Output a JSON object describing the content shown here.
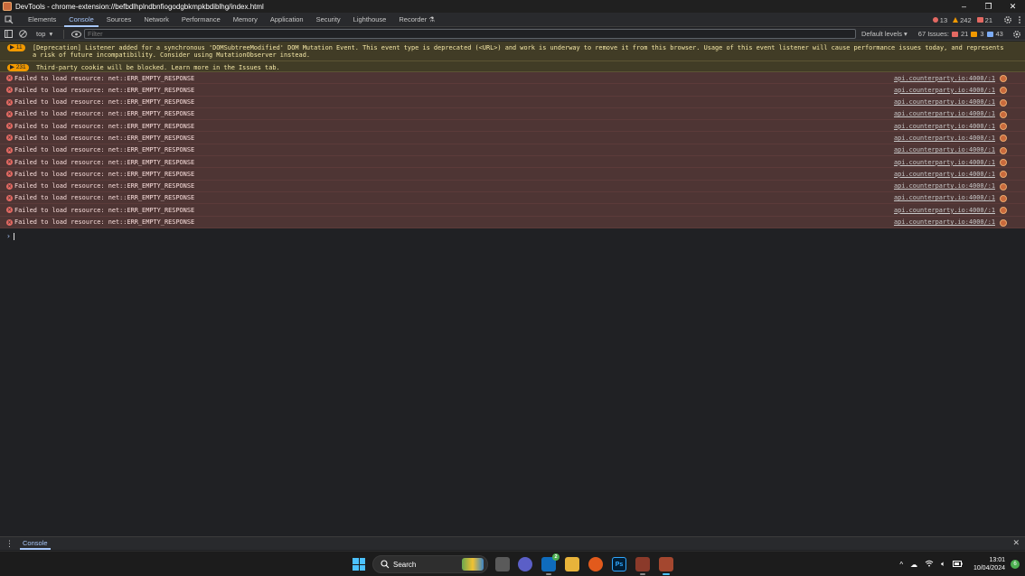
{
  "window": {
    "title": "DevTools - chrome-extension://befbdlhplndbnfiogodgbkmpkbdiblhg/index.html",
    "controls": {
      "minimize": "–",
      "maximize": "❐",
      "close": "✕"
    }
  },
  "tabs": [
    {
      "label": "Elements",
      "active": false
    },
    {
      "label": "Console",
      "active": true
    },
    {
      "label": "Sources",
      "active": false
    },
    {
      "label": "Network",
      "active": false
    },
    {
      "label": "Performance",
      "active": false
    },
    {
      "label": "Memory",
      "active": false
    },
    {
      "label": "Application",
      "active": false
    },
    {
      "label": "Security",
      "active": false
    },
    {
      "label": "Lighthouse",
      "active": false
    },
    {
      "label": "Recorder ⚗",
      "active": false
    }
  ],
  "counters": {
    "errors": "13",
    "warnings": "242",
    "issues": "21"
  },
  "toolbar": {
    "context": "top",
    "filter_placeholder": "Filter",
    "levels": "Default levels",
    "issues_label": "67 Issues:",
    "issues_errors": "21",
    "issues_warnings": "3",
    "issues_info": "43"
  },
  "warnings": [
    {
      "count": "11",
      "text": "[Deprecation] Listener added for a synchronous 'DOMSubtreeModified' DOM Mutation Event. This event type is deprecated (<URL>) and work is underway to remove it from this browser. Usage of this event listener will cause performance issues today, and represents a risk of future incompatibility. Consider using MutationObserver instead."
    },
    {
      "count": "231",
      "text": "Third-party cookie will be blocked. Learn more in the Issues tab."
    }
  ],
  "errors": {
    "text": "Failed to load resource: net::ERR_EMPTY_RESPONSE",
    "source": "api.counterparty.io:4000/:1",
    "rows": 13
  },
  "drawer": {
    "tab": "Console"
  },
  "taskbar": {
    "search_label": "Search",
    "mail_badge": "2",
    "time": "13:01",
    "date": "10/04/2024",
    "notif_count": "6"
  },
  "colors": {
    "accent": "#a8c7fa",
    "error_bg": "#4e3534",
    "warn_bg": "#413c26",
    "error_icon": "#e46962",
    "warn_icon": "#f29900"
  }
}
